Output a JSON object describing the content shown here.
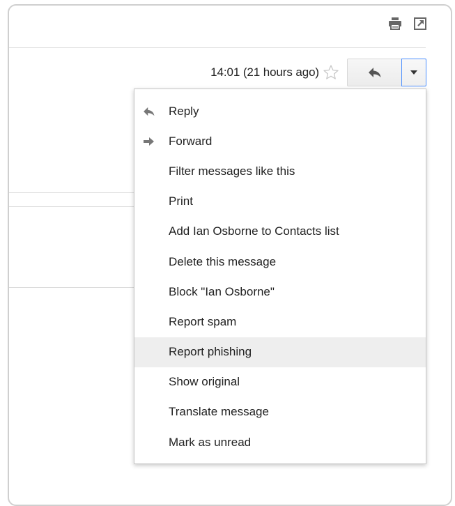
{
  "header": {
    "timestamp": "14:01 (21 hours ago)"
  },
  "icons": {
    "print": "print-icon",
    "new_window": "new-window-icon",
    "star": "star-icon",
    "reply": "reply-arrow-icon",
    "more": "dropdown-arrow-icon"
  },
  "menu": {
    "items": [
      {
        "label": "Reply",
        "icon": "reply-arrow-icon"
      },
      {
        "label": "Forward",
        "icon": "forward-arrow-icon"
      },
      {
        "label": "Filter messages like this"
      },
      {
        "label": "Print"
      },
      {
        "label": "Add Ian Osborne to Contacts list"
      },
      {
        "label": "Delete this message"
      },
      {
        "label": "Block \"Ian Osborne\""
      },
      {
        "label": "Report spam"
      },
      {
        "label": "Report phishing",
        "highlighted": true
      },
      {
        "label": "Show original"
      },
      {
        "label": "Translate message"
      },
      {
        "label": "Mark as unread"
      }
    ]
  },
  "colors": {
    "focus_border": "#4d90fe",
    "highlight_bg": "#eeeeee",
    "icon_gray": "#666666"
  }
}
